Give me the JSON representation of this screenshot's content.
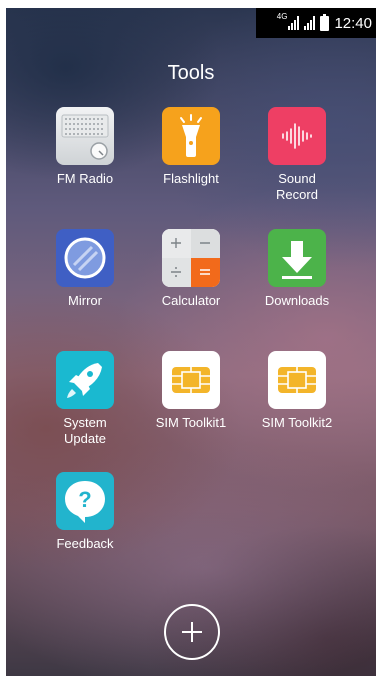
{
  "status_bar": {
    "network": "4G",
    "time": "12:40"
  },
  "header": {
    "title": "Tools"
  },
  "apps": [
    {
      "label": "FM Radio",
      "icon": "fm-radio-icon"
    },
    {
      "label": "Flashlight",
      "icon": "flashlight-icon"
    },
    {
      "label": "Sound\nRecord",
      "icon": "sound-record-icon"
    },
    {
      "label": "Mirror",
      "icon": "mirror-icon"
    },
    {
      "label": "Calculator",
      "icon": "calculator-icon"
    },
    {
      "label": "Downloads",
      "icon": "downloads-icon"
    },
    {
      "label": "System\nUpdate",
      "icon": "system-update-icon"
    },
    {
      "label": "SIM Toolkit1",
      "icon": "sim-card-icon"
    },
    {
      "label": "SIM Toolkit2",
      "icon": "sim-card-icon"
    },
    {
      "label": "Feedback",
      "icon": "feedback-icon"
    }
  ],
  "add_button": {
    "icon": "plus-icon"
  },
  "colors": {
    "fm_radio": "#d9dde0",
    "flashlight": "#f6a21c",
    "sound_record": "#ee3f64",
    "mirror": "#3f5fc4",
    "downloads": "#4cb34a",
    "system_update": "#1ab9d0",
    "sim": "#f3b52a",
    "feedback": "#22b4cd"
  }
}
